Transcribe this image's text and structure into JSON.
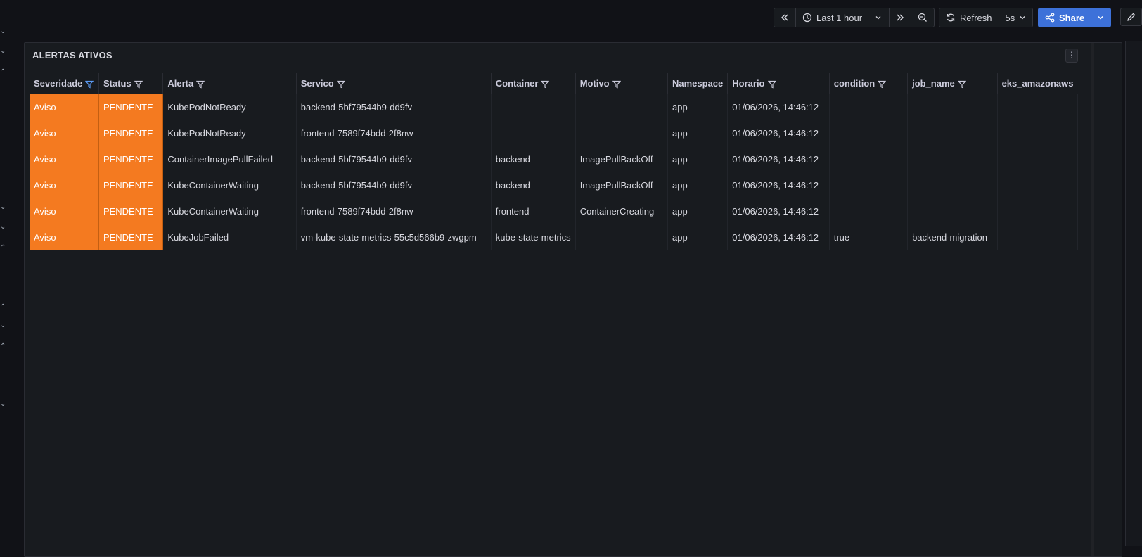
{
  "toolbar": {
    "time_range": "Last 1 hour",
    "refresh_label": "Refresh",
    "refresh_interval": "5s",
    "share_label": "Share"
  },
  "panel": {
    "title": "ALERTAS ATIVOS",
    "columns": [
      "Severidade",
      "Status",
      "Alerta",
      "Servico",
      "Container",
      "Motivo",
      "Namespace",
      "Horario",
      "condition",
      "job_name",
      "eks_amazonaws"
    ],
    "rows": [
      [
        "Aviso",
        "PENDENTE",
        "KubePodNotReady",
        "backend-5bf79544b9-dd9fv",
        "",
        "",
        "app",
        "01/06/2026, 14:46:12",
        "",
        "",
        ""
      ],
      [
        "Aviso",
        "PENDENTE",
        "KubePodNotReady",
        "frontend-7589f74bdd-2f8nw",
        "",
        "",
        "app",
        "01/06/2026, 14:46:12",
        "",
        "",
        ""
      ],
      [
        "Aviso",
        "PENDENTE",
        "ContainerImagePullFailed",
        "backend-5bf79544b9-dd9fv",
        "backend",
        "ImagePullBackOff",
        "app",
        "01/06/2026, 14:46:12",
        "",
        "",
        ""
      ],
      [
        "Aviso",
        "PENDENTE",
        "KubeContainerWaiting",
        "backend-5bf79544b9-dd9fv",
        "backend",
        "ImagePullBackOff",
        "app",
        "01/06/2026, 14:46:12",
        "",
        "",
        ""
      ],
      [
        "Aviso",
        "PENDENTE",
        "KubeContainerWaiting",
        "frontend-7589f74bdd-2f8nw",
        "frontend",
        "ContainerCreating",
        "app",
        "01/06/2026, 14:46:12",
        "",
        "",
        ""
      ],
      [
        "Aviso",
        "PENDENTE",
        "KubeJobFailed",
        "vm-kube-state-metrics-55c5d566b9-zwgpm",
        "kube-state-metrics",
        "",
        "app",
        "01/06/2026, 14:46:12",
        "true",
        "backend-migration",
        ""
      ]
    ]
  },
  "colors": {
    "warning": "#f47a20",
    "accent": "#3d71d9",
    "background": "#111217",
    "panel": "#181b1f"
  },
  "icons": [
    "chevron-double-left-icon",
    "clock-icon",
    "chevron-down-icon",
    "chevron-double-right-icon",
    "zoom-out-icon",
    "refresh-icon",
    "share-icon",
    "pencil-icon",
    "filter-icon",
    "kebab-menu-icon"
  ]
}
